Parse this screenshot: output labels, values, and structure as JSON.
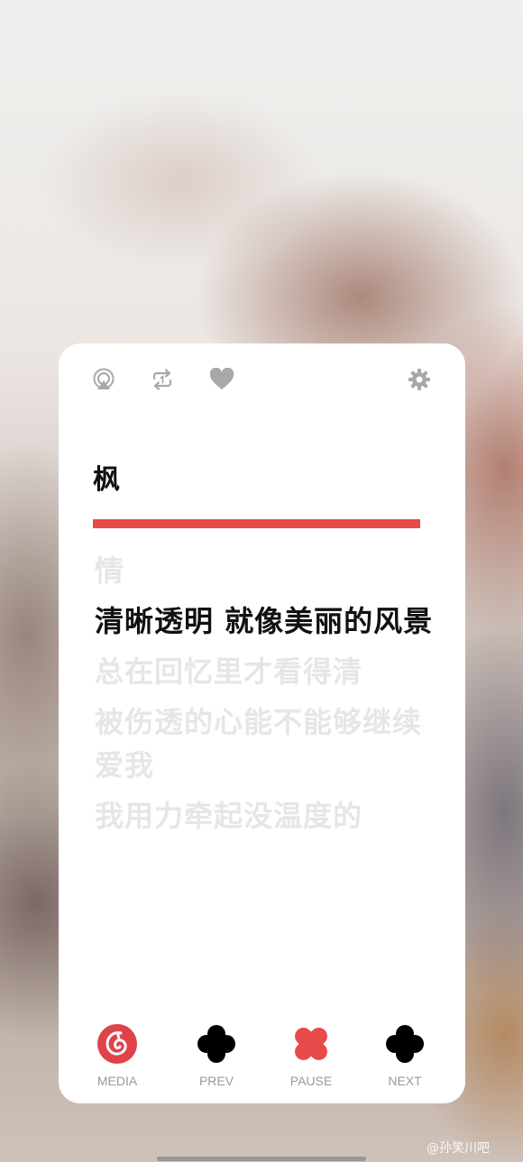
{
  "song": {
    "title": "枫",
    "progress": 1.0
  },
  "lyrics": [
    {
      "text": "情",
      "current": false
    },
    {
      "text": "清晰透明 就像美丽的风景",
      "current": true
    },
    {
      "text": "总在回忆里才看得清",
      "current": false
    },
    {
      "text": "被伤透的心能不能够继续爱我",
      "current": false
    },
    {
      "text": "我用力牵起没温度的",
      "current": false
    }
  ],
  "top_icons": [
    "airplay-icon",
    "repeat-one-icon",
    "heart-icon",
    "gear-icon"
  ],
  "controls": [
    {
      "label": "MEDIA",
      "icon": "netease-music-icon"
    },
    {
      "label": "PREV",
      "icon": "plus-shape-icon"
    },
    {
      "label": "PAUSE",
      "icon": "x-shape-icon"
    },
    {
      "label": "NEXT",
      "icon": "plus-shape-icon"
    }
  ],
  "colors": {
    "accent": "#e84a4a",
    "media": "#e0424a",
    "icon_gray": "#a8a8a8"
  },
  "watermark": "@孙笑川吧"
}
